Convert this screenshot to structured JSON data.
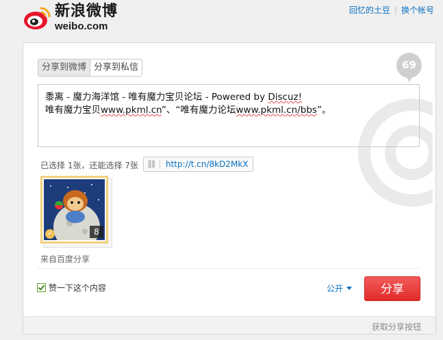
{
  "header": {
    "logo_cn": "新浪微博",
    "logo_en": "weibo.com",
    "links": [
      "回忆的土豆",
      "换个帐号"
    ]
  },
  "tabs": [
    "分享到微博",
    "分享到私信"
  ],
  "char_counter": "69",
  "post": {
    "line1_prefix": "黍离 - 魔力海洋馆 - 唯有魔力宝贝论坛 - Powered by ",
    "line1_url": "Discuz!",
    "line2_a": "唯有魔力宝贝",
    "line2_url1": "www.pkml.cn",
    "line2_b": "”、“唯有魔力论坛",
    "line2_url2": "www.pkml.cn/bbs",
    "line2_c": "”。"
  },
  "selection_info": "已选择 1张，还能选择 7张",
  "short_url": "http://t.cn/8kD2MkX",
  "thumbnail": {
    "count": "8"
  },
  "source": "来自百度分享",
  "like_label": "赞一下这个内容",
  "visibility": "公开",
  "share_button": "分享",
  "footer_link": "获取分享按钮",
  "colors": {
    "accent": "#0a6fbf",
    "share_button": "#e12b2b",
    "selected_border": "#f0d07a"
  }
}
